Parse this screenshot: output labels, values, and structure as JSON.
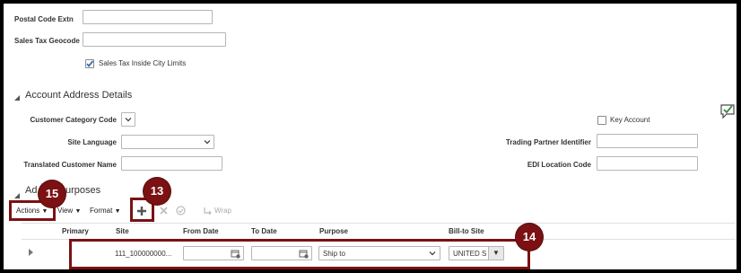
{
  "address": {
    "postal_code_extn_label": "Postal Code Extn",
    "sales_tax_geocode_label": "Sales Tax Geocode",
    "sales_tax_inside_city_label": "Sales Tax Inside City Limits",
    "sales_tax_inside_city_checked": true
  },
  "account_address": {
    "title": "Account Address Details",
    "customer_category_code_label": "Customer Category Code",
    "site_language_label": "Site Language",
    "translated_customer_name_label": "Translated Customer Name",
    "key_account_label": "Key Account",
    "trading_partner_identifier_label": "Trading Partner Identifier",
    "edi_location_code_label": "EDI Location Code"
  },
  "purposes": {
    "title_left": "Ad",
    "title_right": "urposes",
    "toolbar": {
      "actions": "Actions",
      "view": "View",
      "format": "Format",
      "wrap": "Wrap"
    },
    "columns": [
      "Primary",
      "Site",
      "From Date",
      "To Date",
      "Purpose",
      "Bill-to Site"
    ],
    "row": {
      "site": "111_100000000...",
      "purpose": "Ship to",
      "bill_to_site": "UNITED S"
    }
  },
  "callouts": {
    "c13": "13",
    "c14": "14",
    "c15": "15"
  },
  "colors": {
    "callout": "#7b1113",
    "checkmark": "#2f6fb3"
  }
}
